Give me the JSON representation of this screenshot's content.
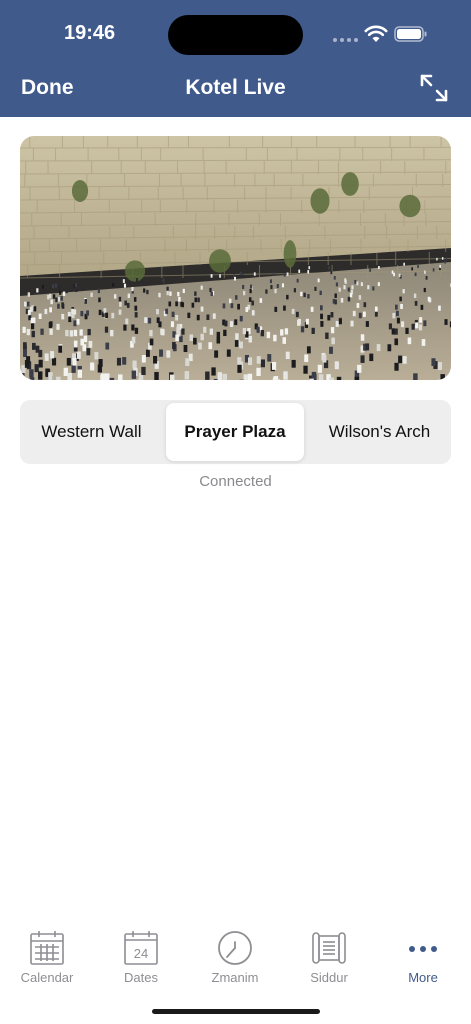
{
  "status_bar": {
    "time": "19:46"
  },
  "nav": {
    "done_label": "Done",
    "title": "Kotel Live"
  },
  "segments": [
    {
      "label": "Western Wall"
    },
    {
      "label": "Prayer Plaza",
      "selected": true
    },
    {
      "label": "Wilson's Arch"
    }
  ],
  "connection_status": "Connected",
  "tabbar": {
    "items": [
      {
        "label": "Calendar",
        "icon": "calendar-icon"
      },
      {
        "label": "Dates",
        "icon": "date-24-icon",
        "icon_text": "24"
      },
      {
        "label": "Zmanim",
        "icon": "clock-icon"
      },
      {
        "label": "Siddur",
        "icon": "scroll-icon"
      },
      {
        "label": "More",
        "icon": "more-dots-icon",
        "active": true
      }
    ]
  },
  "colors": {
    "header": "#405a8c",
    "accent": "#405a8c",
    "inactive": "#8e8e93"
  }
}
